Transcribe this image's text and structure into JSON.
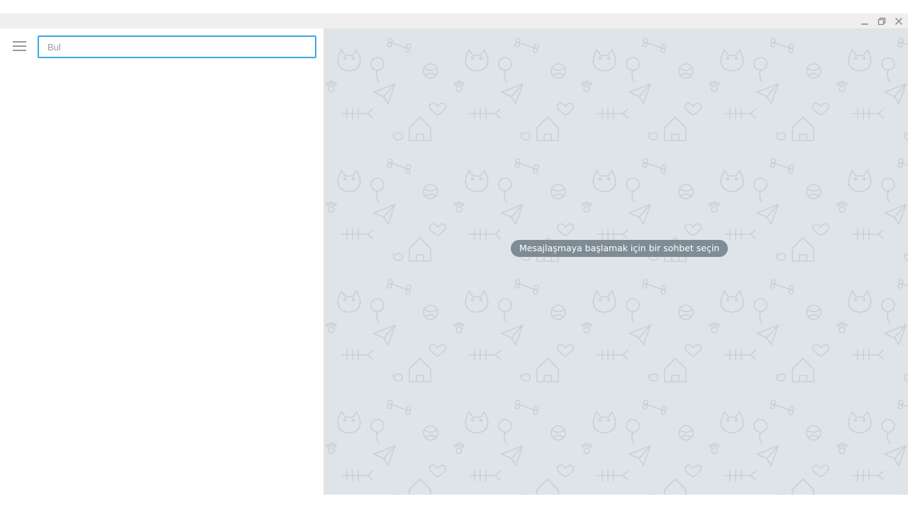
{
  "window": {
    "controls": {
      "minimize_icon": "minimize-icon",
      "restore_icon": "restore-icon",
      "close_icon": "close-icon"
    }
  },
  "sidebar": {
    "menu_icon": "hamburger-menu-icon",
    "search": {
      "placeholder": "Bul",
      "value": ""
    }
  },
  "chat": {
    "empty_state_message": "Mesajlaşmaya başlamak için bir sohbet seçin",
    "background_color": "#dfe4e8",
    "pattern": "cats-doodle-pattern"
  },
  "colors": {
    "accent": "#40a7e3",
    "titlebar": "#efefef",
    "pill": "#6e7c86"
  }
}
